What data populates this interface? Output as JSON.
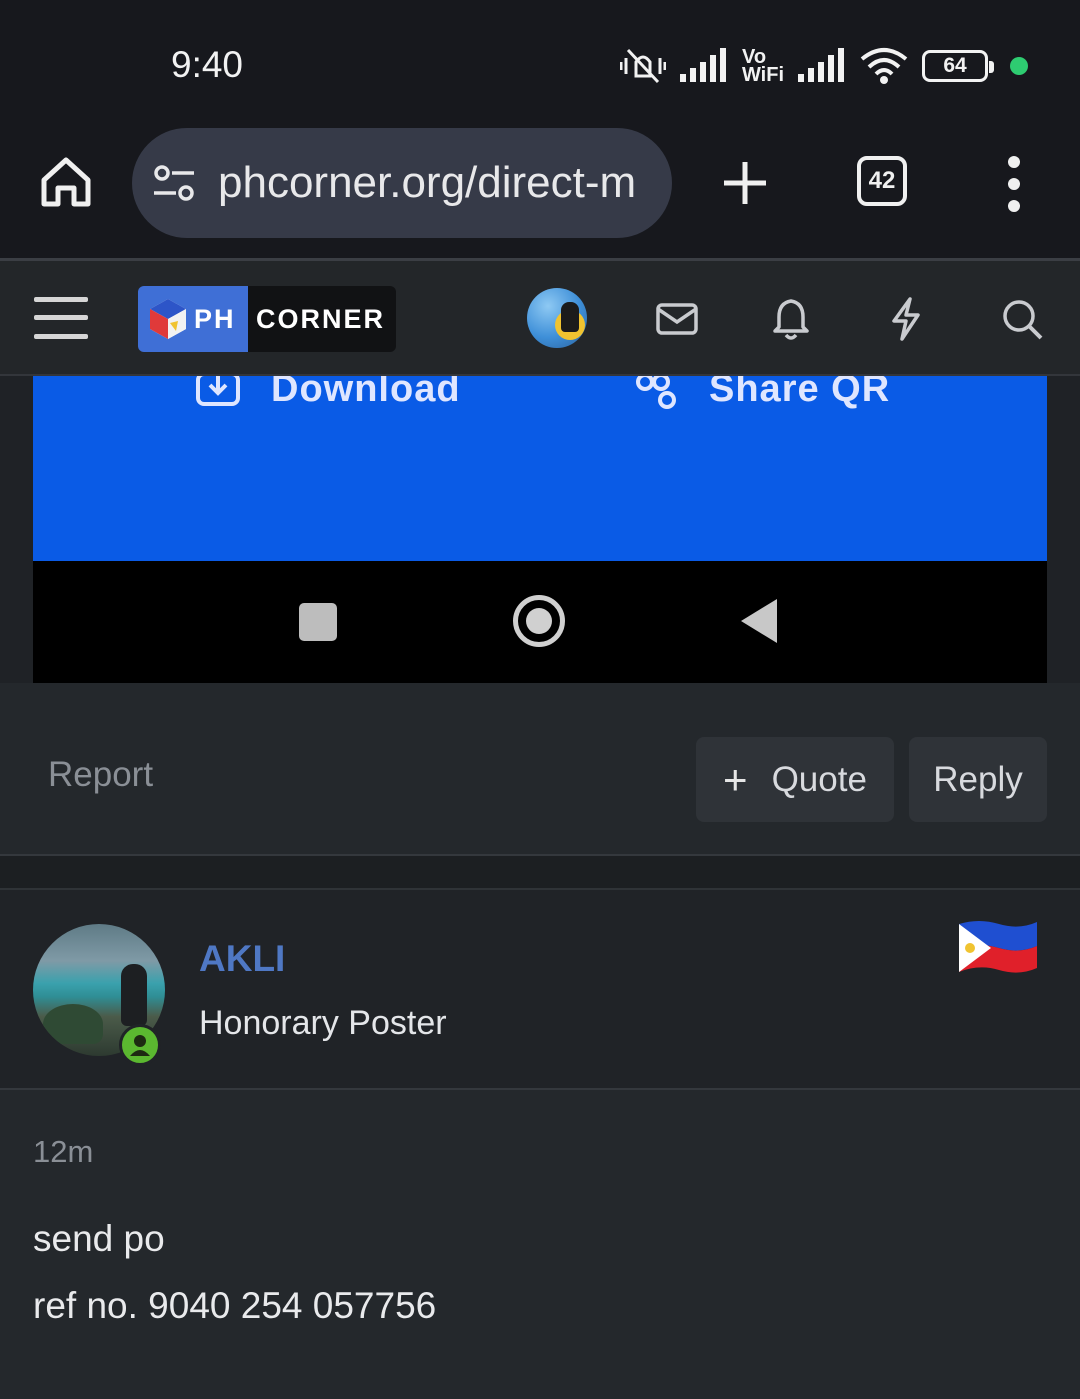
{
  "status_bar": {
    "time": "9:40",
    "vowifi_top": "Vo",
    "vowifi_bottom": "WiFi",
    "battery": "64",
    "icons": [
      "mute-vibrate-icon",
      "signal-icon",
      "vowifi-icon",
      "signal-icon",
      "wifi-icon",
      "battery-icon",
      "green-dot"
    ]
  },
  "browser": {
    "url": "phcorner.org/direct-m",
    "tab_count": "42",
    "icons": [
      "home-icon",
      "site-settings-icon",
      "plus-icon",
      "tabs-icon",
      "more-vert-icon"
    ]
  },
  "site_header": {
    "logo_ph": "PH",
    "logo_corner": "CORNER",
    "icons": [
      "hamburger-icon",
      "avatar",
      "mail-icon",
      "bell-icon",
      "bolt-icon",
      "search-icon"
    ]
  },
  "embed": {
    "download_label": "Download",
    "share_label": "Share QR",
    "blue": "#0a5be6"
  },
  "post_actions": {
    "report": "Report",
    "quote": "Quote",
    "reply": "Reply"
  },
  "post": {
    "author": "AKLI",
    "author_title": "Honorary Poster",
    "time": "12m",
    "lines": [
      "send po",
      "ref no. 9040 254 057756"
    ],
    "flag": "philippines-flag-icon",
    "author_color": "#4f78c4"
  }
}
